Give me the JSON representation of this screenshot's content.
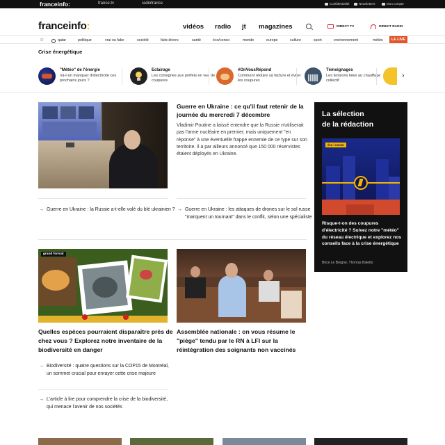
{
  "topbar": {
    "brand": "franceinfo:",
    "links": [
      "france.tv",
      "radiofrance"
    ],
    "utils": [
      "Confidentialité",
      "Newsletters",
      "Mon compte"
    ]
  },
  "header": {
    "logo_text": "franceinfo",
    "logo_colon": ":",
    "nav": [
      "vidéos",
      "radio",
      "jt",
      "magazines"
    ],
    "direct_tv": "DIRECT TV",
    "direct_radio": "DIRECT RADIO"
  },
  "subnav": {
    "items": [
      "qatar",
      "politique",
      "vrai ou fake",
      "société",
      "faits-divers",
      "santé",
      "éco/conso",
      "monde",
      "europe",
      "culture",
      "sport",
      "environnement",
      "météo"
    ],
    "live_label": "LE LIVE"
  },
  "section_title": "Crise énergétique",
  "carousel": [
    {
      "title": "\"Météo\" de l'énergie",
      "subtitle": "Va-t-on manquer d'électricité ces prochains jours ?"
    },
    {
      "title": "Eclairage",
      "subtitle": "Les consignes aux préfets en vue de coupures"
    },
    {
      "title": "#OnVousRépond",
      "subtitle": "Comment réduire sa facture et éviter les coupures"
    },
    {
      "title": "Témoignages",
      "subtitle": "Les tensions liées au chauffage collectif"
    }
  ],
  "main_article": {
    "title": "Guerre en Ukraine : ce qu'il faut retenir de la journée du mercredi 7 décembre",
    "summary": "Vladimir Poutine a laissé entendre que la Russie n'utiliserait pas l'arme nucléaire en premier, mais uniquement \"en réponse\" à une éventuelle frappe ennemie de ce type sur son territoire. Il a par ailleurs annoncé que 150 000 réservistes étaient déployés en Ukraine."
  },
  "related": [
    "Guerre en Ukraine : la Russie a-t-elle volé du blé ukrainien ?",
    "Guerre en Ukraine : les attaques de drones sur le sol russe \"marquent un tournant\" dans le conflit, selon une spécialiste"
  ],
  "article_biodiv": {
    "badge": "grand format",
    "title": "Quelles espèces pourraient disparaître près de chez vous ? Explorez notre inventaire de la biodiversité en danger",
    "related": [
      "Biodiversité : quatre questions sur la COP15 de Montréal, un sommet crucial pour enrayer cette crise majeure",
      "L'article à lire pour comprendre la crise de la biodiversité, qui menace l'avenir de nos sociétés"
    ]
  },
  "article_assemblee": {
    "title": "Assemblée nationale : on vous résume le \"piège\" tendu par le RN à LFI sur la réintégration des soignants non vaccinés"
  },
  "sidebar": {
    "title_line1": "La sélection",
    "title_line2": "de la rédaction",
    "tag": "éco / conso",
    "description": "Risque-t-on des coupures d'électricité ? Suivez notre \"météo\" du réseau électrique et explorez nos conseils face à la crise énergétique",
    "authors": "Brice Le Borgne, Thomas Baietto"
  },
  "colors": {
    "accent": "#f5b400",
    "live": "#e2542a",
    "direct": "#dd2233"
  }
}
